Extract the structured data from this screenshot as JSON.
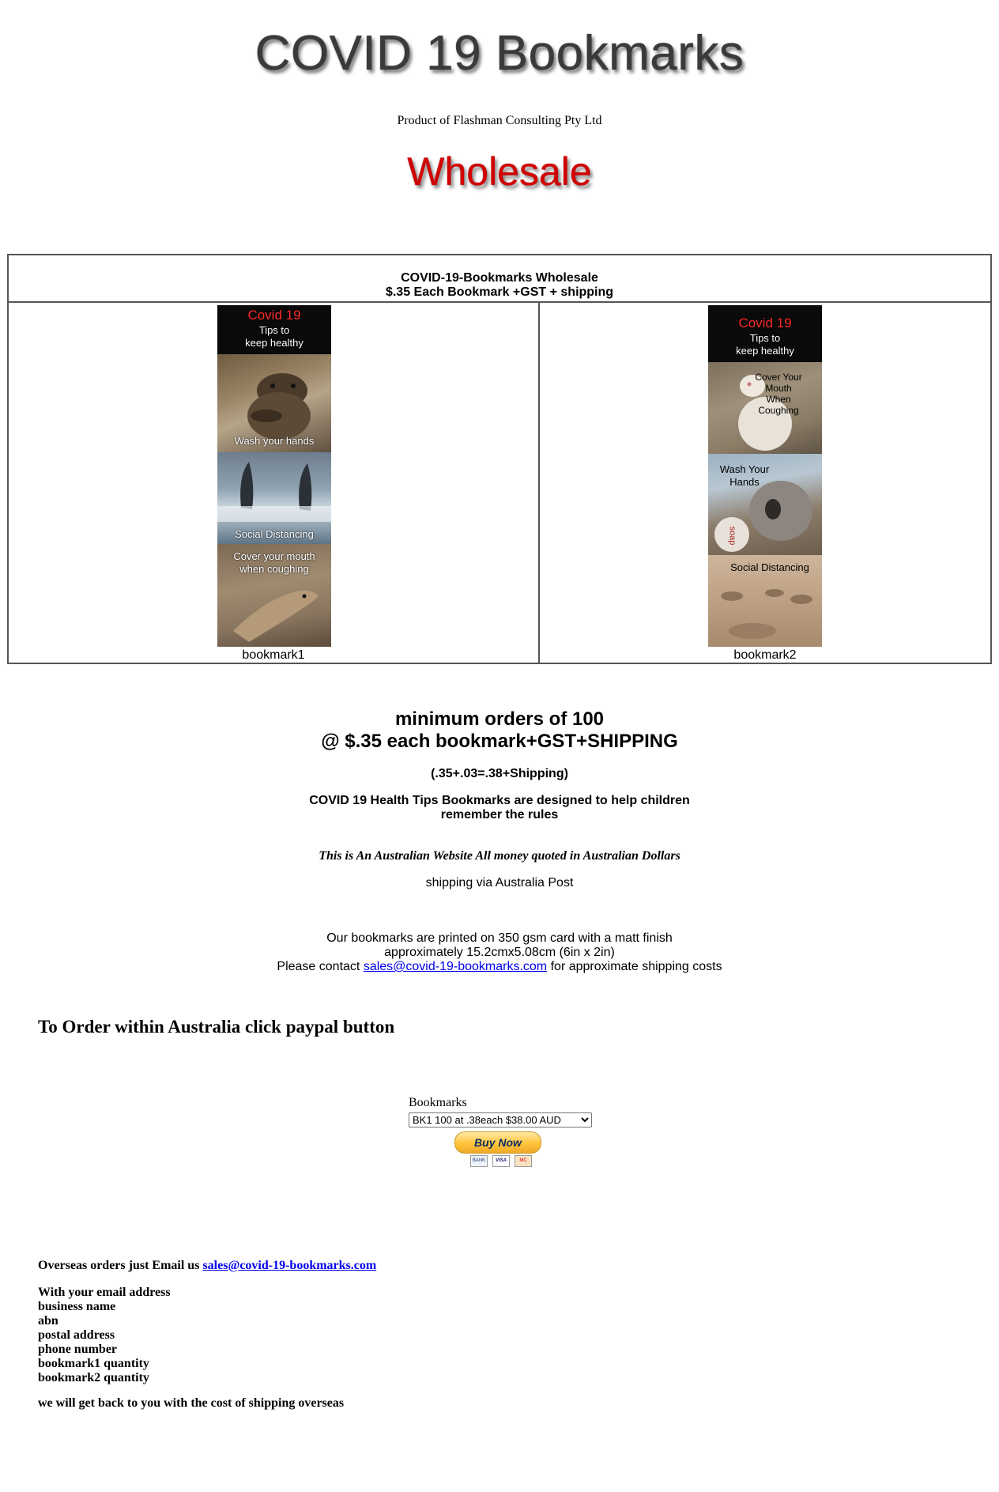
{
  "header": {
    "title": "COVID 19 Bookmarks",
    "subtitle": "Product of Flashman Consulting Pty Ltd",
    "banner": "Wholesale"
  },
  "table": {
    "heading_line1": "COVID-19-Bookmarks Wholesale",
    "heading_line2": "$.35 Each Bookmark +GST + shipping",
    "bookmark1": {
      "caption": "bookmark1",
      "panel_title": "Covid 19",
      "panel_subtitle1": "Tips to",
      "panel_subtitle2": "keep healthy",
      "text_wash": "Wash your hands",
      "text_social": "Social Distancing",
      "text_cover1": "Cover your mouth",
      "text_cover2": "when coughing"
    },
    "bookmark2": {
      "caption": "bookmark2",
      "panel_title": "Covid 19",
      "panel_subtitle1": "Tips to",
      "panel_subtitle2": "keep healthy",
      "text_cover1": "Cover Your",
      "text_cover2": "Mouth",
      "text_cover3": "When",
      "text_cover4": "Coughing",
      "text_wash1": "Wash Your",
      "text_wash2": "Hands",
      "text_soap": "soap",
      "text_social": "Social Distancing"
    }
  },
  "pricing": {
    "min_orders_line1": "minimum orders of 100",
    "min_orders_line2": "@ $.35 each bookmark+GST+SHIPPING",
    "calc": "(.35+.03=.38+Shipping)",
    "designed_line1": "COVID 19 Health Tips Bookmarks are designed to help children",
    "designed_line2": "remember the rules",
    "australian_note": "This is An Australian Website All money quoted in Australian Dollars",
    "shipping": "shipping via Australia Post"
  },
  "print_info": {
    "line1": "Our bookmarks are printed on 350 gsm card with a matt finish",
    "line2": "approximately 15.2cmx5.08cm (6in x 2in)",
    "contact_prefix": "Please contact",
    "contact_email": "sales@covid-19-bookmarks.com",
    "contact_suffix": "for approximate shipping costs"
  },
  "order": {
    "heading": "To Order within Australia click paypal button",
    "select_label": "Bookmarks",
    "select_value": "BK1 100 at .38each $38.00 AUD",
    "buy_now": "Buy Now",
    "cards": [
      "BANK",
      "VISA",
      "MC"
    ]
  },
  "overseas": {
    "prefix": "Overseas orders just Email us",
    "email": "sales@covid-19-bookmarks.com",
    "details": [
      "With your email address",
      "business name",
      "abn",
      "postal address",
      "phone number",
      "bookmark1 quantity",
      "bookmark2 quantity"
    ],
    "followup": "we will get back to you with the cost of shipping overseas"
  },
  "colors": {
    "title_text": "#3a3a3a",
    "banner_red": "#d40000",
    "link_blue": "#0000ee",
    "paypal_gold": "#ffc439"
  }
}
